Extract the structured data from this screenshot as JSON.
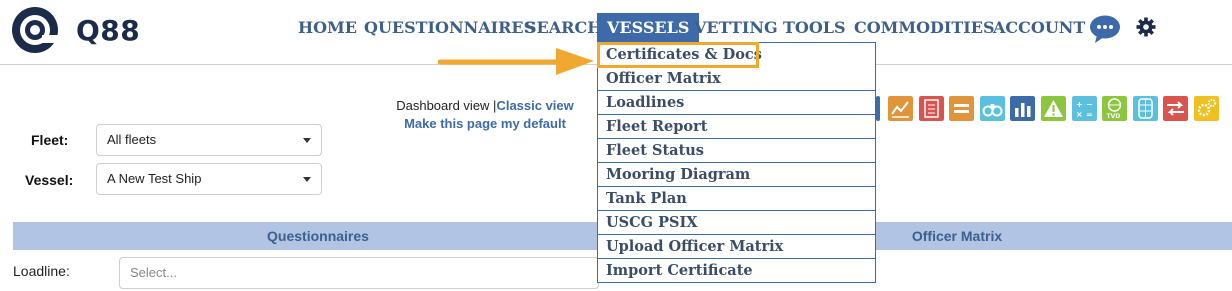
{
  "brand": {
    "name": "Q88"
  },
  "nav": {
    "items": [
      {
        "label": "HOME",
        "name": "nav-home"
      },
      {
        "label": "QUESTIONNAIRES",
        "name": "nav-questionnaires"
      },
      {
        "label": "SEARCH",
        "name": "nav-search"
      },
      {
        "label": "VESSELS",
        "name": "nav-vessels",
        "active": true
      },
      {
        "label": "VETTING",
        "name": "nav-vetting"
      },
      {
        "label": "TOOLS",
        "name": "nav-tools"
      },
      {
        "label": "COMMODITIES",
        "name": "nav-commodities"
      },
      {
        "label": "ACCOUNT",
        "name": "nav-account"
      }
    ]
  },
  "view": {
    "dashboard": "Dashboard view |",
    "classic": "Classic view",
    "default": "Make this page my default"
  },
  "filters": {
    "fleet_label": "Fleet:",
    "fleet_value": "All fleets",
    "vessel_label": "Vessel:",
    "vessel_value": "A New Test Ship"
  },
  "sections": {
    "questionnaires": "Questionnaires",
    "officer_matrix": "Officer Matrix"
  },
  "loadline": {
    "label": "Loadline:",
    "placeholder": "Select..."
  },
  "vessels_menu": {
    "items": [
      "Certificates & Docs",
      "Officer Matrix",
      "Loadlines",
      "Fleet Report",
      "Fleet Status",
      "Mooring Diagram",
      "Tank Plan",
      "USCG PSIX",
      "Upload Officer Matrix",
      "Import Certificate"
    ],
    "highlighted_index": 0
  },
  "toolbar_icons": [
    {
      "name": "trend-chart-icon",
      "color": "#e0953a"
    },
    {
      "name": "document-list-icon",
      "color": "#d9534f"
    },
    {
      "name": "equals-icon",
      "color": "#e0953a"
    },
    {
      "name": "binoculars-icon",
      "color": "#5bc0de"
    },
    {
      "name": "bar-chart-icon",
      "color": "#3d6aa8"
    },
    {
      "name": "warning-icon",
      "color": "#8cc63f"
    },
    {
      "name": "calculator-icon",
      "color": "#5bc0de"
    },
    {
      "name": "tvd-globe-icon",
      "color": "#8cc63f"
    },
    {
      "name": "tank-diagram-icon",
      "color": "#5bc0de"
    },
    {
      "name": "transfer-arrows-icon",
      "color": "#d9534f"
    },
    {
      "name": "gears-icon",
      "color": "#f0c020"
    }
  ],
  "colors": {
    "nav_text": "#3d5f8c",
    "nav_active_bg": "#3d6aa8",
    "section_bar": "#b1c4e4",
    "highlight": "#f0a830",
    "brand_dark": "#1c2b4a"
  }
}
